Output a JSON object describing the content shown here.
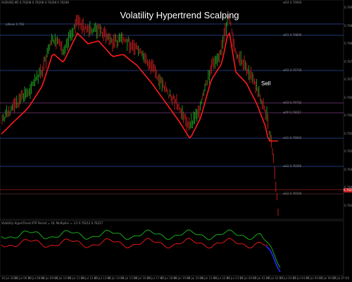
{
  "header": {
    "symbol_info": "AUDUSD,M5 0.76208 0.76208 0.76208 0.76208",
    "title": "Volatility Hypertrend Scalping",
    "sell_label": "Sell"
  },
  "levels": [
    {
      "name": "pWeek",
      "label": "pWeek 0.766"
    },
    {
      "name": "wR1",
      "label": "wR1 0.76806"
    },
    {
      "name": "wR2",
      "label": "wR2 0.76759"
    },
    {
      "name": "wR3",
      "label": "wR3 0.76702"
    },
    {
      "name": "wPP",
      "label": "wPP 0.76657"
    },
    {
      "name": "wS1",
      "label": "wS1 0.76603"
    },
    {
      "name": "wS2",
      "label": "wS2 0.76560"
    },
    {
      "name": "wS3",
      "label": "wS3 0.76500"
    },
    {
      "name": "top_ref",
      "label": "wR4 0.76900"
    }
  ],
  "price_axis": [
    "0.76900",
    "0.76850",
    "0.76800",
    "0.76750",
    "0.76700",
    "0.76650",
    "0.76600",
    "0.76550",
    "0.76500",
    "0.76450",
    "0.76400",
    "0.76350"
  ],
  "current_price": "0.76208",
  "indicator_header": "Volatility HyperTrend ATR Period = 16, Multiplier = 3.5 0.76212 0.76227",
  "time_axis": [
    "16 Jul 2020",
    "16 Jul 06:00",
    "16 Jul 08:00",
    "16 Jul 09:00",
    "16 Jul 10:00",
    "16 Jul 11:00",
    "16 Jul 12:00",
    "16 Jul 13:00",
    "16 Jul 14:00",
    "16 Jul 15:00",
    "16 Jul 16:00",
    "16 Jul 17:00",
    "16 Jul 18:00",
    "16 Jul 19:00",
    "16 Jul 20:00",
    "16 Jul 21:00",
    "16 Jul 22:00",
    "16 Jul 23:00",
    "17 Jul 00:00",
    "17 Jul 01:00",
    "17 Jul 02:00",
    "17 Jul 03:00",
    "17 Jul 04:00",
    "17 Jul 05:00",
    "17 Jul 06:00",
    "17 Jul 07:00"
  ],
  "colors": {
    "bull": "#1fa81f",
    "bear": "#c81e1e",
    "ma": "#ff1a1a",
    "indicator_upper": "#1aa81a",
    "indicator_lower": "#e01818",
    "indicator_blue": "#2a2aff",
    "grid_blue": "#2b4a9a",
    "grid_purple": "#7a3a7a",
    "grid_red": "#a02020"
  }
}
